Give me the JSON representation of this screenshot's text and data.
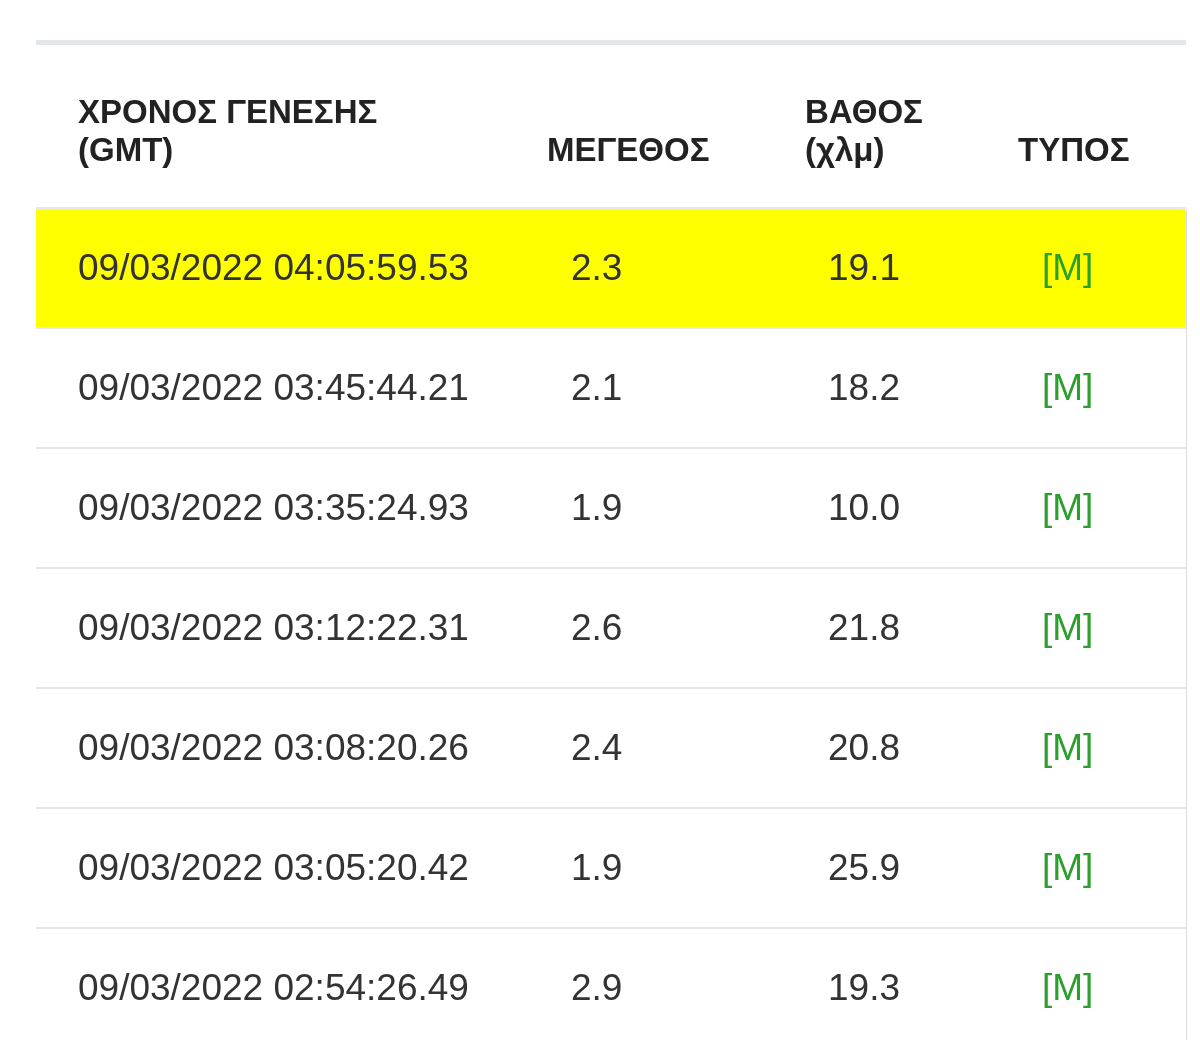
{
  "table": {
    "columns": [
      "ΧΡΟΝΟΣ ΓΕΝΕΣΗΣ\n(GMT)",
      "ΜΕΓΕΘΟΣ",
      "ΒΑΘΟΣ\n(χλμ)",
      "ΤΥΠΟΣ"
    ],
    "rows": [
      {
        "time": "09/03/2022 04:05:59.53",
        "magnitude": "2.3",
        "depth": "19.1",
        "type": "[M]",
        "selected": true
      },
      {
        "time": "09/03/2022 03:45:44.21",
        "magnitude": "2.1",
        "depth": "18.2",
        "type": "[M]",
        "selected": false
      },
      {
        "time": "09/03/2022 03:35:24.93",
        "magnitude": "1.9",
        "depth": "10.0",
        "type": "[M]",
        "selected": false
      },
      {
        "time": "09/03/2022 03:12:22.31",
        "magnitude": "2.6",
        "depth": "21.8",
        "type": "[M]",
        "selected": false
      },
      {
        "time": "09/03/2022 03:08:20.26",
        "magnitude": "2.4",
        "depth": "20.8",
        "type": "[M]",
        "selected": false
      },
      {
        "time": "09/03/2022 03:05:20.42",
        "magnitude": "1.9",
        "depth": "25.9",
        "type": "[M]",
        "selected": false
      },
      {
        "time": "09/03/2022 02:54:26.49",
        "magnitude": "2.9",
        "depth": "19.3",
        "type": "[M]",
        "selected": false
      }
    ]
  }
}
